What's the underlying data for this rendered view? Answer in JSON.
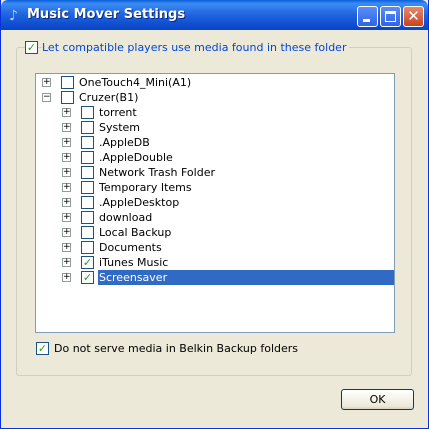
{
  "window": {
    "title": "Music Mover Settings"
  },
  "options": {
    "top_checkbox_label": "Let compatible players use media found in these folder",
    "top_checked": true,
    "bottom_checkbox_label": "Do not serve media in Belkin Backup folders",
    "bottom_checked": true
  },
  "tree": {
    "roots": [
      {
        "label": "OneTouch4_Mini(A1)",
        "expanded": false,
        "checked": false
      },
      {
        "label": "Cruzer(B1)",
        "expanded": true,
        "checked": false
      }
    ],
    "children": [
      {
        "label": "torrent",
        "checked": false
      },
      {
        "label": "System",
        "checked": false
      },
      {
        "label": ".AppleDB",
        "checked": false
      },
      {
        "label": ".AppleDouble",
        "checked": false
      },
      {
        "label": "Network Trash Folder",
        "checked": false
      },
      {
        "label": "Temporary Items",
        "checked": false
      },
      {
        "label": ".AppleDesktop",
        "checked": false
      },
      {
        "label": "download",
        "checked": false
      },
      {
        "label": "Local Backup",
        "checked": false
      },
      {
        "label": "Documents",
        "checked": false
      },
      {
        "label": "iTunes Music",
        "checked": true
      },
      {
        "label": "Screensaver",
        "checked": true,
        "selected": true
      }
    ],
    "expand_glyph": "+",
    "collapse_glyph": "−",
    "check_glyph": "✓"
  },
  "buttons": {
    "ok_label": "OK",
    "close_glyph": "✕"
  },
  "colors": {
    "titlebar": "#0a45c2",
    "selection": "#316ac5",
    "check_green": "#21a121"
  }
}
